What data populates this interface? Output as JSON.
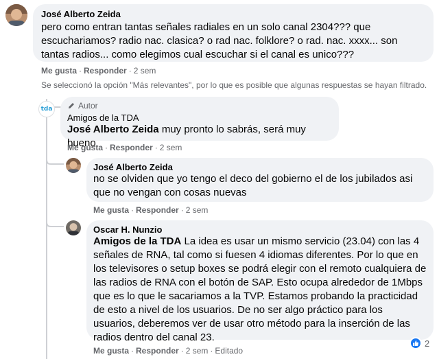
{
  "comment1": {
    "author": "José Alberto Zeida",
    "text": "pero como entran tantas señales radiales en un solo canal 2304??? que escuchariamos? radio nac. clasica? o rad nac. folklore? o rad. nac. xxxx... son tantas radios... como elegimos cual escuchar si el canal es unico???",
    "like": "Me gusta",
    "reply": "Responder",
    "time": "2 sem"
  },
  "filter_notice": "Se seleccionó la opción \"Más relevantes\", por lo que es posible que algunas respuestas se hayan filtrado.",
  "reply1": {
    "badge": "Autor",
    "author": "Amigos de la TDA",
    "mention": "José Alberto Zeida",
    "text": " muy pronto lo sabrás, será muy bueno",
    "like": "Me gusta",
    "reply": "Responder",
    "time": "2 sem",
    "avatar_text": "tda"
  },
  "reply2": {
    "author": "José Alberto Zeida",
    "text": "no se olviden que yo tengo el deco del gobierno el de los jubilados asi que no vengan con cosas nuevas",
    "like": "Me gusta",
    "reply": "Responder",
    "time": "2 sem"
  },
  "reply3": {
    "author": "Oscar H. Nunzio",
    "mention": "Amigos de la TDA",
    "text": " La idea es usar un mismo servicio (23.04) con las 4 señales de RNA, tal como si fuesen 4 idiomas diferentes. Por lo que en los televisores o setup boxes se podrá elegir con el remoto cualquiera de las radios de RNA con el botón de SAP. Esto ocupa alrededor de 1Mbps que es lo que le sacariamos a la TVP. Estamos probando la practicidad de esto a nivel de los usuarios. De no ser algo práctico para los usuarios, deberemos ver de usar otro método para la inserción de las radios dentro del canal 23.",
    "like": "Me gusta",
    "reply": "Responder",
    "time": "2 sem",
    "edited": "Editado",
    "reaction_count": "2"
  },
  "colors": {
    "bubble": "#f0f2f5",
    "secondary_text": "#65676b",
    "like_blue": "#1877f2",
    "tda_blue": "#2a9fd6"
  }
}
